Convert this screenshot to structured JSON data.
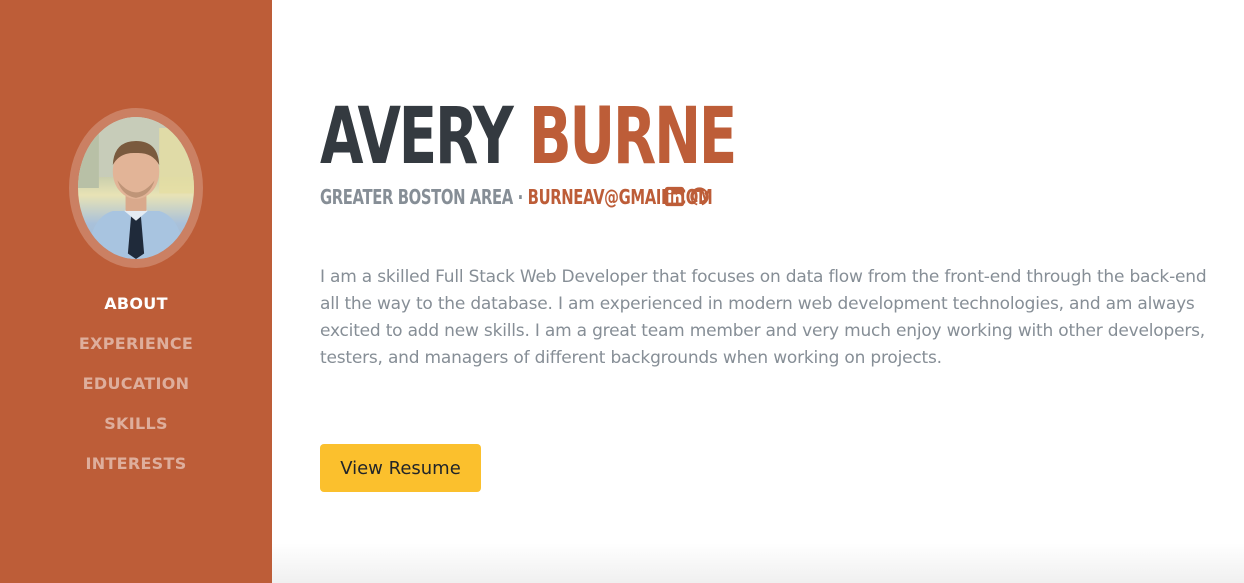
{
  "sidebar": {
    "background": "#bd5d38",
    "avatar_icon": "profile-photo",
    "nav": [
      {
        "label": "ABOUT",
        "active": true
      },
      {
        "label": "EXPERIENCE",
        "active": false
      },
      {
        "label": "EDUCATION",
        "active": false
      },
      {
        "label": "SKILLS",
        "active": false
      },
      {
        "label": "INTERESTS",
        "active": false
      }
    ]
  },
  "header": {
    "first_name": "AVERY",
    "last_name": "BURNE",
    "location": "GREATER BOSTON AREA",
    "separator": " · ",
    "email": "BURNEAV@GMAIL.COM",
    "social_icons": [
      "linkedin-icon",
      "github-icon"
    ]
  },
  "about": {
    "text": "I am a skilled Full Stack Web Developer that focuses on data flow from the front-end through the back-end all the way to the database. I am experienced in modern web development technologies, and am always excited to add new skills. I am a great team member and very much enjoy working with other developers, testers, and managers of different backgrounds when working on projects."
  },
  "actions": {
    "resume_label": "View Resume"
  },
  "colors": {
    "primary": "#bd5d38",
    "heading": "#343a40",
    "muted": "#868e96",
    "button": "#fbc02d"
  }
}
